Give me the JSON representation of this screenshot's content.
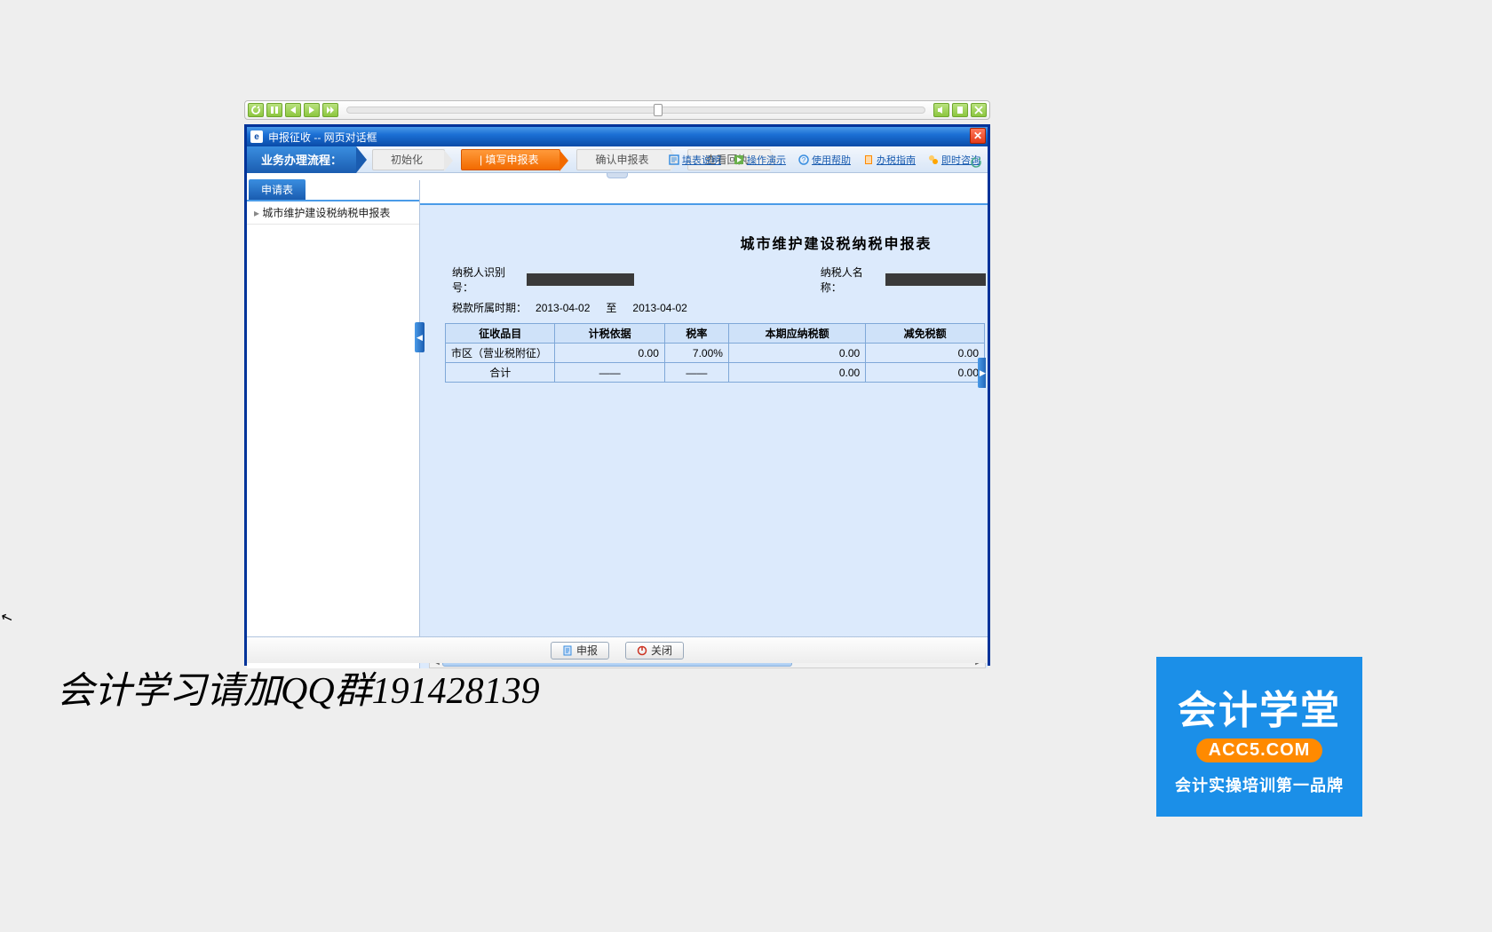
{
  "player": {
    "thumb_percent": 53
  },
  "window": {
    "title": "申报征收 -- 网页对话框"
  },
  "flow": {
    "label": "业务办理流程：",
    "steps": [
      "初始化",
      "| 填写申报表",
      "确认申报表",
      "查看回执"
    ],
    "active_index": 1
  },
  "help_links": [
    "填表说明",
    "操作演示",
    "使用帮助",
    "办税指南",
    "即时咨询"
  ],
  "sidebar": {
    "tab": "申请表",
    "item": "城市维护建设税纳税申报表"
  },
  "form": {
    "title": "城市维护建设税纳税申报表",
    "labels": {
      "taxpayer_id": "纳税人识别号：",
      "taxpayer_name": "纳税人名称：",
      "period": "税款所属时期：",
      "to": "至"
    },
    "period_from": "2013-04-02",
    "period_to": "2013-04-02",
    "columns": [
      "征收品目",
      "计税依据",
      "税率",
      "本期应纳税额",
      "减免税额"
    ],
    "rows": [
      {
        "item": "市区（营业税附征）",
        "basis": "0.00",
        "rate": "7.00%",
        "payable": "0.00",
        "exempt": "0.00"
      }
    ],
    "total": {
      "label": "合计",
      "basis": "——",
      "rate": "——",
      "payable": "0.00",
      "exempt": "0.00"
    }
  },
  "buttons": {
    "declare": "申报",
    "close": "关闭"
  },
  "overlay": {
    "calli": "会计学习请加QQ群191428139",
    "brand_title": "会计学堂",
    "brand_url": "ACC5.COM",
    "brand_sub": "会计实操培训第一品牌"
  }
}
